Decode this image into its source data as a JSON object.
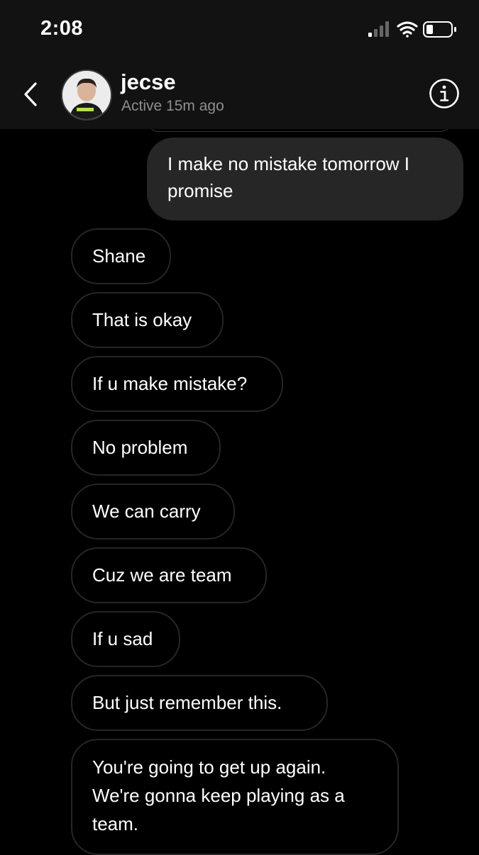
{
  "status_bar": {
    "time": "2:08"
  },
  "header": {
    "name": "jecse",
    "active_status": "Active 15m ago",
    "back_icon": "chevron-left-icon",
    "info_icon": "info-circle-icon"
  },
  "messages": [
    {
      "from": "me",
      "text": "I make no mistake tomorrow I promise"
    },
    {
      "from": "them",
      "text": "Shane"
    },
    {
      "from": "them",
      "text": "That is okay"
    },
    {
      "from": "them",
      "text": "If u make mistake?"
    },
    {
      "from": "them",
      "text": "No problem"
    },
    {
      "from": "them",
      "text": "We can carry"
    },
    {
      "from": "them",
      "text": "Cuz we are team"
    },
    {
      "from": "them",
      "text": "If u sad"
    },
    {
      "from": "them",
      "text": "But just remember this."
    },
    {
      "from": "them",
      "text": "You're going to get up again. We're gonna keep playing as a team."
    }
  ],
  "colors": {
    "background": "#000000",
    "header_bg": "#121212",
    "sent_bubble": "#262626",
    "received_border": "#262626",
    "secondary_text": "#8e8e8e"
  }
}
